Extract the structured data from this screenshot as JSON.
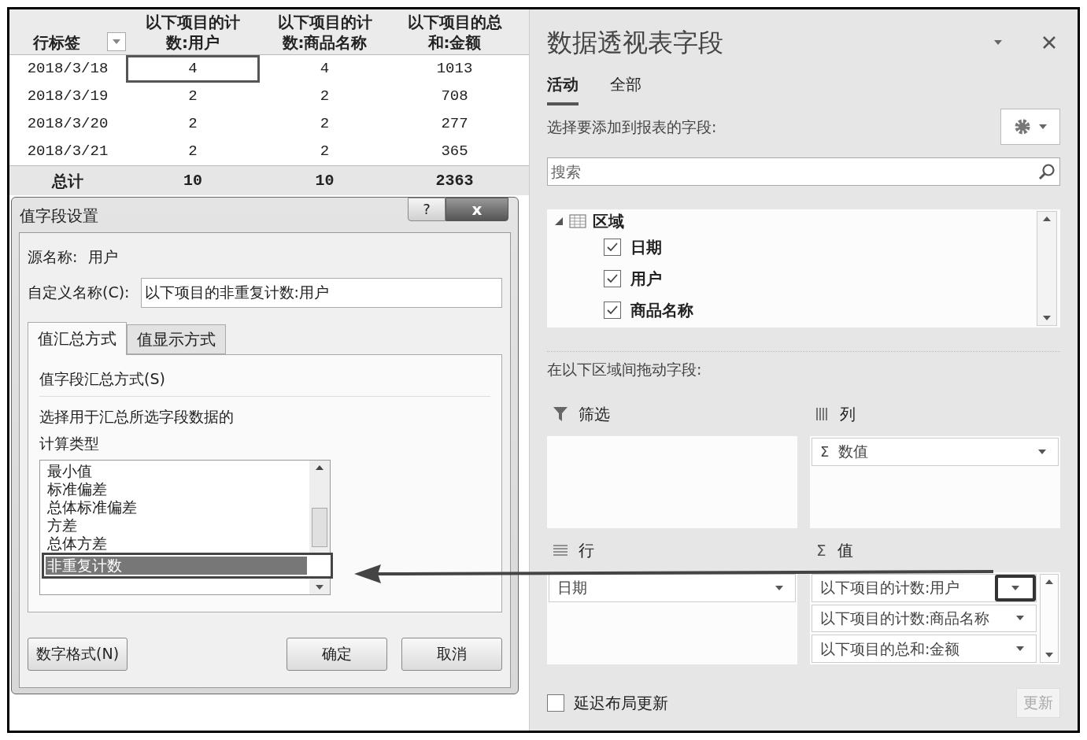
{
  "pivot_table": {
    "header": [
      {
        "text": "行标签",
        "filter": true
      },
      {
        "text": "以下项目的计数:用户",
        "filter": false
      },
      {
        "text": "以下项目的计数:商品名称",
        "filter": false
      },
      {
        "text": "以下项目的总和:金额",
        "filter": false
      }
    ],
    "rows": [
      {
        "label": "2018/3/18",
        "cells": [
          {
            "text": "4",
            "selected": true
          },
          {
            "text": "4",
            "selected": false
          },
          {
            "text": "1013",
            "selected": false
          }
        ]
      },
      {
        "label": "2018/3/19",
        "cells": [
          {
            "text": "2",
            "selected": false
          },
          {
            "text": "2",
            "selected": false
          },
          {
            "text": "708",
            "selected": false
          }
        ]
      },
      {
        "label": "2018/3/20",
        "cells": [
          {
            "text": "2",
            "selected": false
          },
          {
            "text": "2",
            "selected": false
          },
          {
            "text": "277",
            "selected": false
          }
        ]
      },
      {
        "label": "2018/3/21",
        "cells": [
          {
            "text": "2",
            "selected": false
          },
          {
            "text": "2",
            "selected": false
          },
          {
            "text": "365",
            "selected": false
          }
        ]
      }
    ],
    "total": {
      "label": "总计",
      "values": [
        "10",
        "10",
        "2363"
      ]
    }
  },
  "dialog": {
    "title": "值字段设置",
    "help": "?",
    "close": "x",
    "source_label": "源名称:",
    "source_value": "用户",
    "custom_name_label": "自定义名称(C):",
    "custom_name_value": "以下项目的非重复计数:用户",
    "tabs": [
      {
        "label": "值汇总方式",
        "selected": true
      },
      {
        "label": "值显示方式",
        "selected": false
      }
    ],
    "section_title": "值字段汇总方式(S)",
    "description": "选择用于汇总所选字段数据的计算类型",
    "functions": [
      {
        "text": "最小值",
        "selected": false
      },
      {
        "text": "标准偏差",
        "selected": false
      },
      {
        "text": "总体标准偏差",
        "selected": false
      },
      {
        "text": "方差",
        "selected": false
      },
      {
        "text": "总体方差",
        "selected": false
      },
      {
        "text": "非重复计数",
        "selected": true
      }
    ],
    "buttons": [
      {
        "label": "数字格式(N)",
        "kind": "left"
      },
      {
        "label": "确定",
        "kind": "right"
      },
      {
        "label": "取消",
        "kind": "right"
      }
    ]
  },
  "field_panel": {
    "title": "数据透视表字段",
    "tabs": [
      {
        "label": "活动",
        "selected": true
      },
      {
        "label": "全部",
        "selected": false
      }
    ],
    "prompt": "选择要添加到报表的字段:",
    "search_placeholder": "搜索",
    "tree": {
      "label": "区域",
      "expanded": true,
      "children": [
        {
          "label": "日期",
          "checked": true
        },
        {
          "label": "用户",
          "checked": true
        },
        {
          "label": "商品名称",
          "checked": true
        }
      ]
    },
    "drag_prompt": "在以下区域间拖动字段:",
    "areas": [
      {
        "kind": "filter",
        "label": "筛选"
      },
      {
        "kind": "columns",
        "label": "列",
        "items": [
          {
            "prefix": "Σ",
            "text": "数值"
          }
        ]
      },
      {
        "kind": "rows",
        "label": "行",
        "items": [
          {
            "text": "日期"
          }
        ]
      },
      {
        "kind": "values",
        "symbol": "Σ",
        "label": "值",
        "items": [
          {
            "text": "以下项目的计数:用户"
          },
          {
            "text": "以下项目的计数:商品名称"
          },
          {
            "text": "以下项目的总和:金额"
          }
        ]
      }
    ],
    "defer_update": {
      "label": "延迟布局更新",
      "checked": false
    },
    "update_button": {
      "label": "更新",
      "disabled": true
    }
  }
}
